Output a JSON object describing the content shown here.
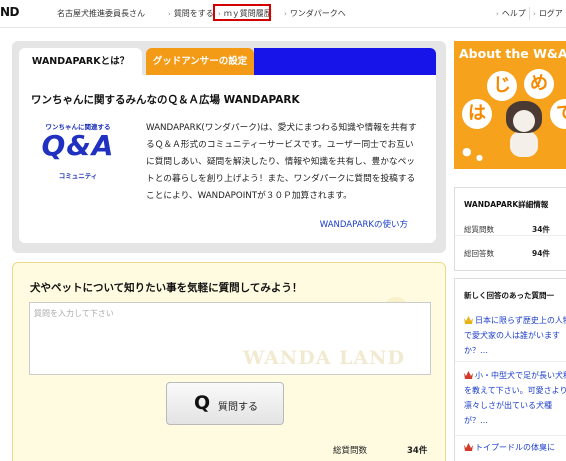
{
  "header": {
    "logo": "ND",
    "user_name": "名古屋犬推進委員長さん",
    "nav": {
      "ask": "質問をする",
      "history": "ｍｙ質問履歴",
      "wandapark": "ワンダパークへ",
      "help": "ヘルプ",
      "logout": "ログア"
    },
    "highlight_color": "#d40000"
  },
  "tabs": {
    "about": "WANDAPARKとは？",
    "good_answer": "グッドアンサーの設定"
  },
  "intro": {
    "title": "ワンちゃんに関するみんなのＱ＆Ａ広場 WANDAPARK",
    "logo_top": "ワンちゃんに関連する",
    "logo_main": "Q&A",
    "logo_bottom": "コミュニティ",
    "description": "WANDAPARK(ワンダパーク)は、愛犬にまつわる知識や情報を共有するＱ＆Ａ形式のコミュニティーサービスです。ユーザー同士でお互いに質問しあい、疑問を解決したり、情報や知識を共有し、豊かなペットとの暮らしを創り上げよう！また、ワンダパークに質問を投稿することにより、WANDAPOINTが３０Ｐ加算されます。",
    "howto_link": "WANDAPARKの使い方"
  },
  "question": {
    "title": "犬やペットについて知りたい事を気軽に質問してみよう！",
    "placeholder": "質問を入力して下さい",
    "watermark": "WANDA LAND",
    "button_icon": "Q",
    "button_label": "質問する",
    "stat_label": "総質問数",
    "stat_value": "34件"
  },
  "banner": {
    "title": "About the W&AL",
    "chars": [
      "は",
      "じ",
      "め",
      "て"
    ]
  },
  "stats": {
    "title": "WANDAPARK詳細情報",
    "questions_label": "総質問数",
    "questions_value": "34件",
    "answers_label": "総回答数",
    "answers_value": "94件"
  },
  "recent": {
    "title": "新しく回答のあった質問一",
    "items": [
      {
        "text": "日本に限らず歴史上の人物で愛犬家の人は誰がいますか？…",
        "icon": "crown-icon-gold"
      },
      {
        "text": "小・中型犬で足が長い犬種を教えて下さい。可愛さより凛々しさが出ている犬種が？…",
        "icon": "crown-icon-red"
      },
      {
        "text": "トイプードルの体臭に",
        "icon": "crown-icon-red"
      }
    ]
  },
  "colors": {
    "tab_orange": "#f39a16",
    "tab_blue": "#1614e8",
    "link_blue": "#1a3cc8",
    "banner_orange": "#f7a21c",
    "question_bg": "#fffbe0"
  }
}
